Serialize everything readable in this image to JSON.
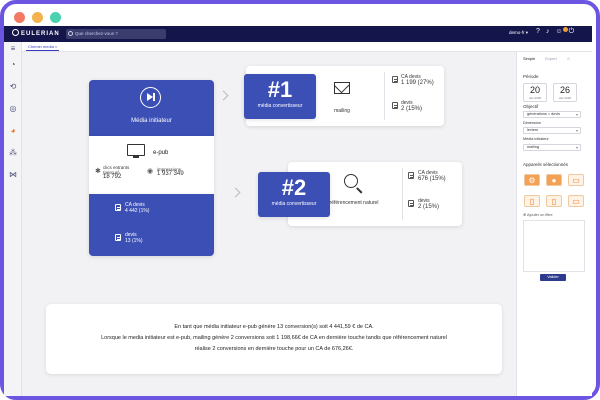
{
  "window": {
    "dot_colors": [
      "#f27a63",
      "#f2b24c",
      "#4ad2b0"
    ],
    "frame_color": "#6c55e0"
  },
  "topbar": {
    "logo": "EULERIAN",
    "search_placeholder": "Que cherchez-vous ?",
    "user": "demo-fr ▾"
  },
  "tabs": [
    "Chemin media"
  ],
  "initiator": {
    "label": "Média initiateur",
    "channel": "e-pub",
    "clicks_label": "clics entrants (perçus)",
    "clicks_value": "18 792",
    "impressions_label": "impressions",
    "impressions_value": "1 937 349",
    "ca_label": "CA devis",
    "ca_value": "4 442 (1%)",
    "devis_label": "devis",
    "devis_value": "13 (1%)"
  },
  "converters": [
    {
      "rank": "#1",
      "rank_label": "média convertisseur",
      "channel": "mailing",
      "ca_label": "CA devis",
      "ca_value": "1 199 (27%)",
      "devis_label": "devis",
      "devis_value": "2 (15%)"
    },
    {
      "rank": "#2",
      "rank_label": "média convertisseur",
      "channel": "référencement naturel",
      "ca_label": "CA devis",
      "ca_value": "676 (15%)",
      "devis_label": "devis",
      "devis_value": "2 (15%)"
    }
  ],
  "summary": [
    "En tant que média initiateur e-pub génère 13 conversion(s) soit 4 441,59 € de CA.",
    "Lorsque le media initiateur est e-pub, mailing génère 2 conversions soit 1 198,66€ de CA en dernière touche tandis que référencement naturel",
    "réalise 2 conversions en dernière touche pour un CA de 676,26€."
  ],
  "panel": {
    "tabs": [
      "Simple",
      "Expert"
    ],
    "period_label": "Période",
    "date_from_day": "20",
    "date_from_month": "Jan 2020",
    "date_to_day": "26",
    "date_to_month": "Jan 2020",
    "objective_label": "Objectif",
    "objective_value": "générations = devis",
    "dimension_label": "Dimension",
    "dimension_value": "leviers",
    "media_label": "Média initiateur",
    "media_value": "mailing",
    "devices_label": "Appareils sélectionnés",
    "add_filter": "Ajouter un filtre",
    "validate": "Valider"
  }
}
